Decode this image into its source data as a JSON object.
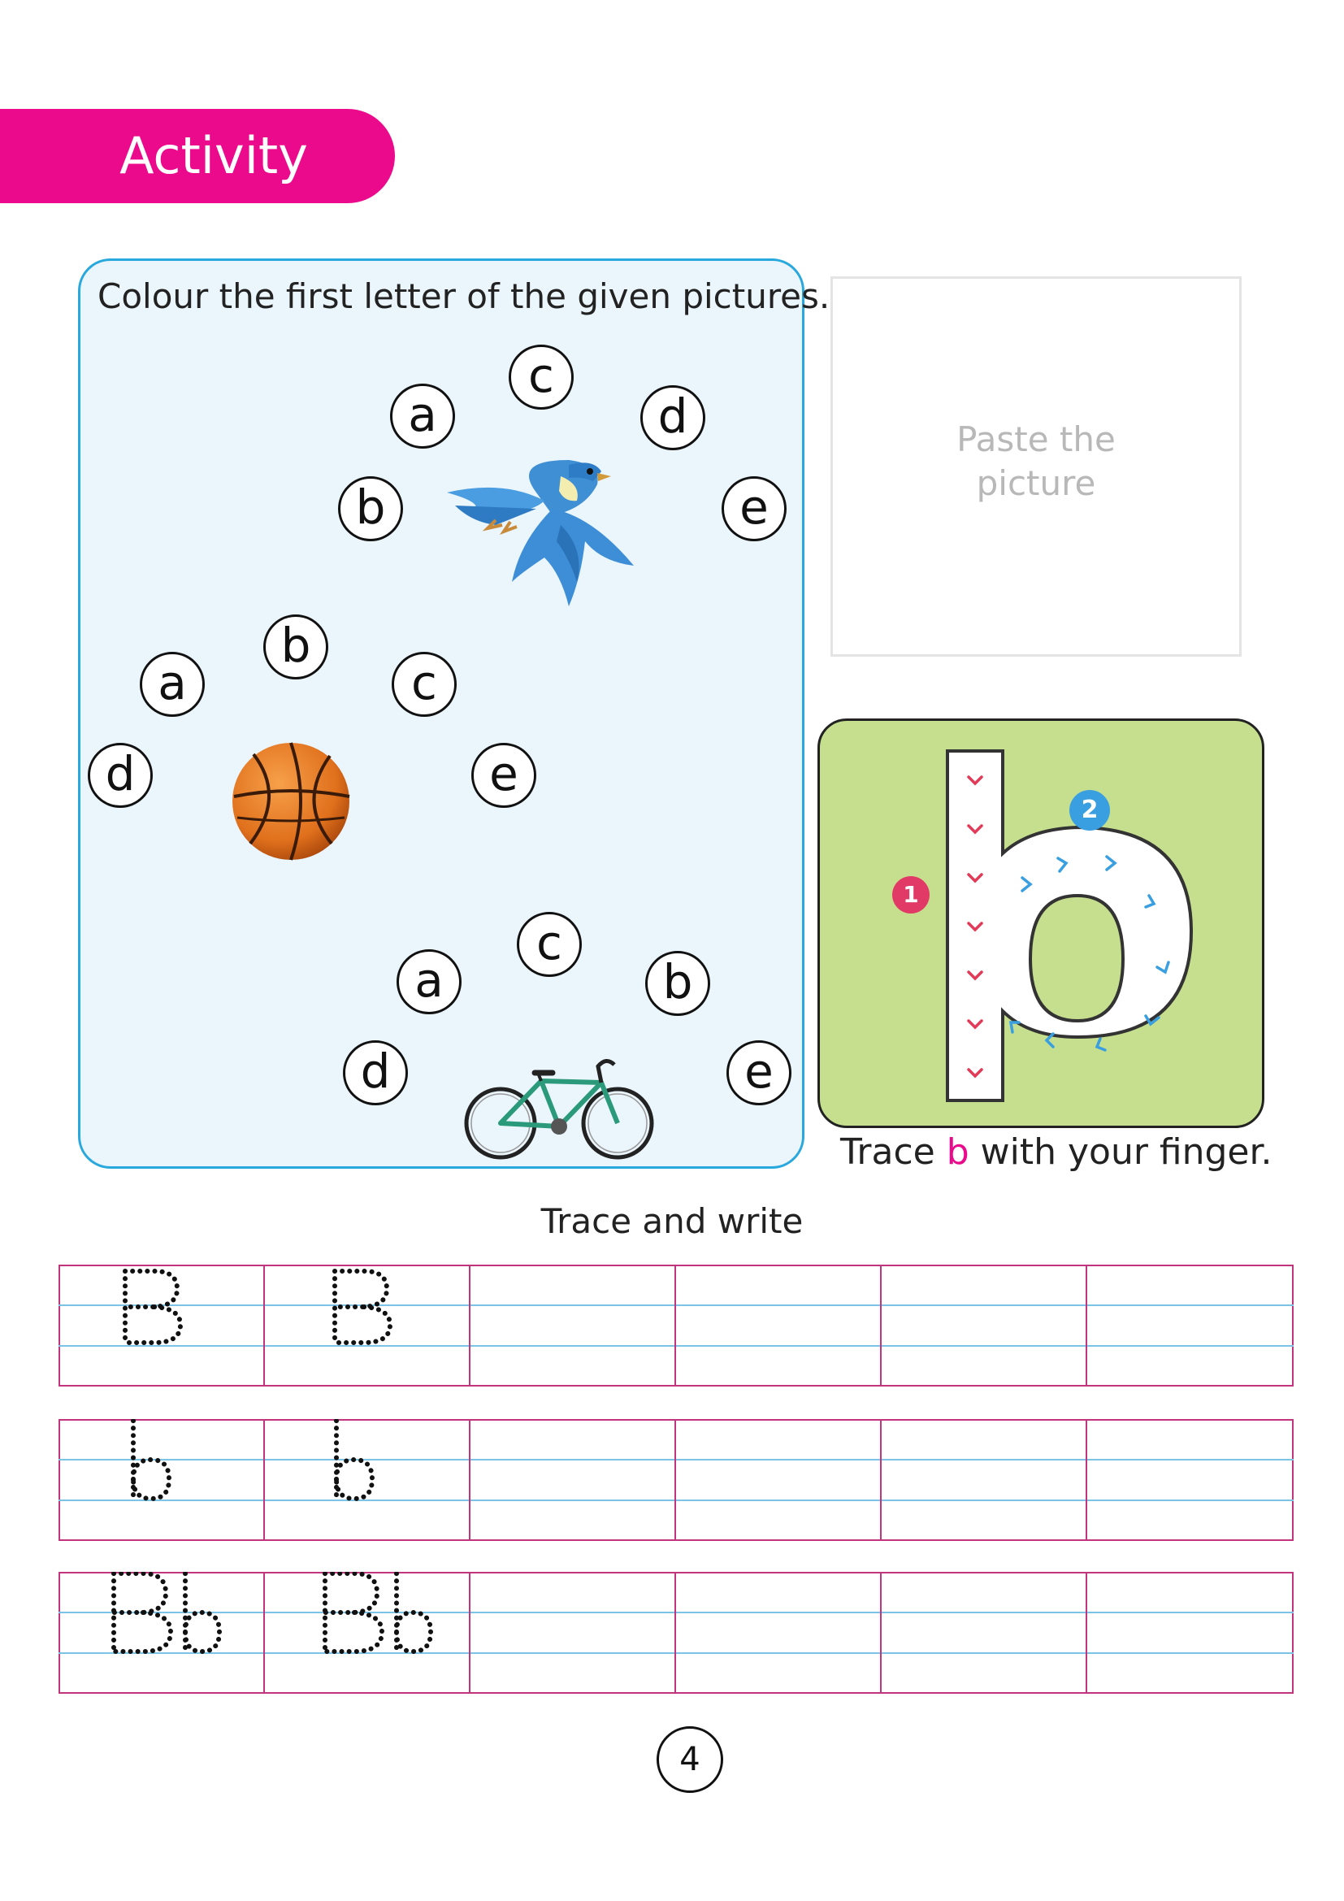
{
  "header": {
    "title": "Activity"
  },
  "colour_activity": {
    "instruction": "Colour the first letter of the given pictures.",
    "groups": [
      {
        "picture": "bird-image",
        "letters": [
          "c",
          "a",
          "d",
          "b",
          "e"
        ]
      },
      {
        "picture": "basketball-image",
        "letters": [
          "b",
          "a",
          "c",
          "d",
          "e"
        ]
      },
      {
        "picture": "bicycle-image",
        "letters": [
          "c",
          "a",
          "b",
          "d",
          "e"
        ]
      }
    ]
  },
  "paste_box": {
    "line1": "Paste the",
    "line2": "picture"
  },
  "finger_trace": {
    "letter": "b",
    "step1": "1",
    "step2": "2",
    "caption_before": "Trace ",
    "caption_letter": "b",
    "caption_after": "  with your finger."
  },
  "trace_write": {
    "heading": "Trace and write",
    "rows": [
      {
        "sample": "B"
      },
      {
        "sample": "b"
      },
      {
        "sample": "Bb"
      }
    ]
  },
  "page": {
    "number": "4"
  },
  "colors": {
    "accent": "#ec0a8c",
    "panel_border": "#29a8dd",
    "card_green": "#c6df8e",
    "guide_pink": "#c2357e",
    "guide_blue": "#7cc4e6"
  }
}
